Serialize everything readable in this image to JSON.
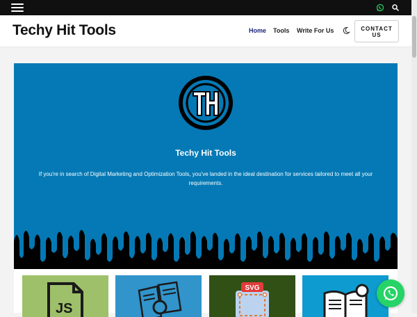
{
  "topbar": {
    "icons": [
      "menu-icon",
      "whatsapp-icon",
      "search-icon"
    ]
  },
  "header": {
    "logo": "Techy Hit Tools",
    "nav": [
      "Home",
      "Tools",
      "Write For Us"
    ],
    "theme_icon": "moon-icon",
    "contact_line1": "CONTACT",
    "contact_line2": "US"
  },
  "hero": {
    "title": "Techy Hit Tools",
    "description": "If you're in search of Digital Marketing and Optimization Tools, you've landed in the ideal destination for services tailored to meet all your requirements.",
    "background_color": "#0479b5"
  },
  "cards": [
    {
      "icon": "js-file-icon",
      "color": "#9ec06a"
    },
    {
      "icon": "documents-icon",
      "color": "#3194cb"
    },
    {
      "icon": "svg-icon",
      "badge": "SVG",
      "color": "#305016"
    },
    {
      "icon": "book-icon",
      "color": "#0e9bd0"
    }
  ],
  "floating": {
    "icon": "whatsapp-icon",
    "color": "#25d366"
  }
}
